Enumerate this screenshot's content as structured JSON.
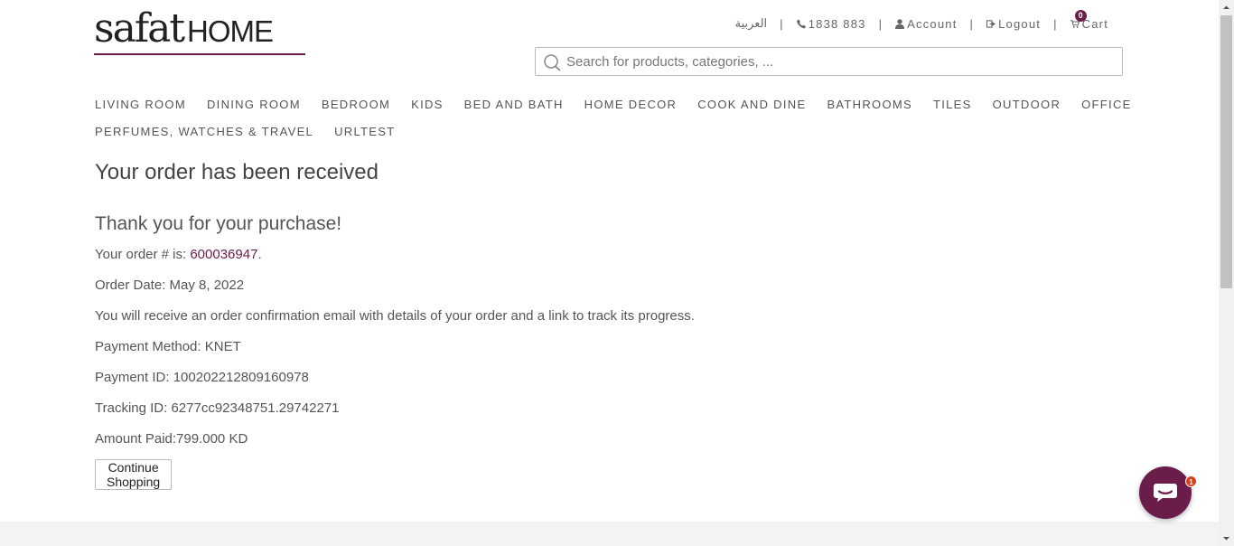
{
  "header": {
    "logo_brand": "safat",
    "logo_home": "HOME",
    "language": "العربية",
    "phone": "1838 883",
    "account": "Account",
    "logout": "Logout",
    "cart": "Cart",
    "cart_count": "0",
    "separator": "|"
  },
  "search": {
    "placeholder": "Search for products, categories, ..."
  },
  "nav": {
    "row1": [
      "LIVING ROOM",
      "DINING ROOM",
      "BEDROOM",
      "KIDS",
      "BED AND BATH",
      "HOME DECOR",
      "COOK AND DINE",
      "BATHROOMS",
      "TILES",
      "OUTDOOR",
      "OFFICE"
    ],
    "row2": [
      "PERFUMES, WATCHES & TRAVEL",
      "URLTEST"
    ]
  },
  "order": {
    "title": "Your order has been received",
    "thank_you": "Thank you for your purchase!",
    "order_number_label": "Your order # is: ",
    "order_number": "600036947",
    "order_number_suffix": ".",
    "order_date": "Order Date: May 8, 2022",
    "confirmation": "You will receive an order confirmation email with details of your order and a link to track its progress.",
    "payment_method": "Payment Method: KNET",
    "payment_id": "Payment ID: 100202212809160978",
    "tracking_id": "Tracking ID: 6277cc92348751.29742271",
    "amount_paid": "Amount Paid:799.000 KD",
    "continue_button": "Continue Shopping"
  },
  "chat": {
    "badge": "1"
  },
  "colors": {
    "brand": "#6b1d4a",
    "chat_badge": "#d9401a"
  }
}
